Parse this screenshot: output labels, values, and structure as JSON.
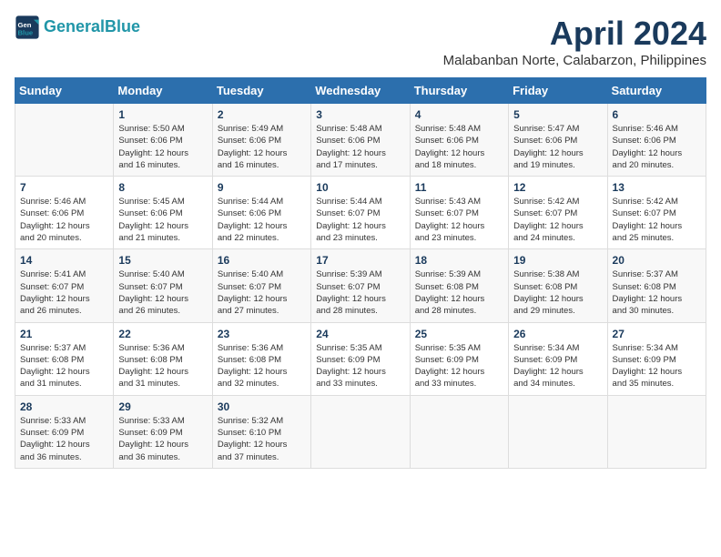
{
  "header": {
    "logo_line1": "General",
    "logo_line2": "Blue",
    "month_title": "April 2024",
    "subtitle": "Malabanban Norte, Calabarzon, Philippines"
  },
  "weekdays": [
    "Sunday",
    "Monday",
    "Tuesday",
    "Wednesday",
    "Thursday",
    "Friday",
    "Saturday"
  ],
  "weeks": [
    [
      {
        "day": "",
        "info": ""
      },
      {
        "day": "1",
        "info": "Sunrise: 5:50 AM\nSunset: 6:06 PM\nDaylight: 12 hours\nand 16 minutes."
      },
      {
        "day": "2",
        "info": "Sunrise: 5:49 AM\nSunset: 6:06 PM\nDaylight: 12 hours\nand 16 minutes."
      },
      {
        "day": "3",
        "info": "Sunrise: 5:48 AM\nSunset: 6:06 PM\nDaylight: 12 hours\nand 17 minutes."
      },
      {
        "day": "4",
        "info": "Sunrise: 5:48 AM\nSunset: 6:06 PM\nDaylight: 12 hours\nand 18 minutes."
      },
      {
        "day": "5",
        "info": "Sunrise: 5:47 AM\nSunset: 6:06 PM\nDaylight: 12 hours\nand 19 minutes."
      },
      {
        "day": "6",
        "info": "Sunrise: 5:46 AM\nSunset: 6:06 PM\nDaylight: 12 hours\nand 20 minutes."
      }
    ],
    [
      {
        "day": "7",
        "info": "Sunrise: 5:46 AM\nSunset: 6:06 PM\nDaylight: 12 hours\nand 20 minutes."
      },
      {
        "day": "8",
        "info": "Sunrise: 5:45 AM\nSunset: 6:06 PM\nDaylight: 12 hours\nand 21 minutes."
      },
      {
        "day": "9",
        "info": "Sunrise: 5:44 AM\nSunset: 6:06 PM\nDaylight: 12 hours\nand 22 minutes."
      },
      {
        "day": "10",
        "info": "Sunrise: 5:44 AM\nSunset: 6:07 PM\nDaylight: 12 hours\nand 23 minutes."
      },
      {
        "day": "11",
        "info": "Sunrise: 5:43 AM\nSunset: 6:07 PM\nDaylight: 12 hours\nand 23 minutes."
      },
      {
        "day": "12",
        "info": "Sunrise: 5:42 AM\nSunset: 6:07 PM\nDaylight: 12 hours\nand 24 minutes."
      },
      {
        "day": "13",
        "info": "Sunrise: 5:42 AM\nSunset: 6:07 PM\nDaylight: 12 hours\nand 25 minutes."
      }
    ],
    [
      {
        "day": "14",
        "info": "Sunrise: 5:41 AM\nSunset: 6:07 PM\nDaylight: 12 hours\nand 26 minutes."
      },
      {
        "day": "15",
        "info": "Sunrise: 5:40 AM\nSunset: 6:07 PM\nDaylight: 12 hours\nand 26 minutes."
      },
      {
        "day": "16",
        "info": "Sunrise: 5:40 AM\nSunset: 6:07 PM\nDaylight: 12 hours\nand 27 minutes."
      },
      {
        "day": "17",
        "info": "Sunrise: 5:39 AM\nSunset: 6:07 PM\nDaylight: 12 hours\nand 28 minutes."
      },
      {
        "day": "18",
        "info": "Sunrise: 5:39 AM\nSunset: 6:08 PM\nDaylight: 12 hours\nand 28 minutes."
      },
      {
        "day": "19",
        "info": "Sunrise: 5:38 AM\nSunset: 6:08 PM\nDaylight: 12 hours\nand 29 minutes."
      },
      {
        "day": "20",
        "info": "Sunrise: 5:37 AM\nSunset: 6:08 PM\nDaylight: 12 hours\nand 30 minutes."
      }
    ],
    [
      {
        "day": "21",
        "info": "Sunrise: 5:37 AM\nSunset: 6:08 PM\nDaylight: 12 hours\nand 31 minutes."
      },
      {
        "day": "22",
        "info": "Sunrise: 5:36 AM\nSunset: 6:08 PM\nDaylight: 12 hours\nand 31 minutes."
      },
      {
        "day": "23",
        "info": "Sunrise: 5:36 AM\nSunset: 6:08 PM\nDaylight: 12 hours\nand 32 minutes."
      },
      {
        "day": "24",
        "info": "Sunrise: 5:35 AM\nSunset: 6:09 PM\nDaylight: 12 hours\nand 33 minutes."
      },
      {
        "day": "25",
        "info": "Sunrise: 5:35 AM\nSunset: 6:09 PM\nDaylight: 12 hours\nand 33 minutes."
      },
      {
        "day": "26",
        "info": "Sunrise: 5:34 AM\nSunset: 6:09 PM\nDaylight: 12 hours\nand 34 minutes."
      },
      {
        "day": "27",
        "info": "Sunrise: 5:34 AM\nSunset: 6:09 PM\nDaylight: 12 hours\nand 35 minutes."
      }
    ],
    [
      {
        "day": "28",
        "info": "Sunrise: 5:33 AM\nSunset: 6:09 PM\nDaylight: 12 hours\nand 36 minutes."
      },
      {
        "day": "29",
        "info": "Sunrise: 5:33 AM\nSunset: 6:09 PM\nDaylight: 12 hours\nand 36 minutes."
      },
      {
        "day": "30",
        "info": "Sunrise: 5:32 AM\nSunset: 6:10 PM\nDaylight: 12 hours\nand 37 minutes."
      },
      {
        "day": "",
        "info": ""
      },
      {
        "day": "",
        "info": ""
      },
      {
        "day": "",
        "info": ""
      },
      {
        "day": "",
        "info": ""
      }
    ]
  ]
}
